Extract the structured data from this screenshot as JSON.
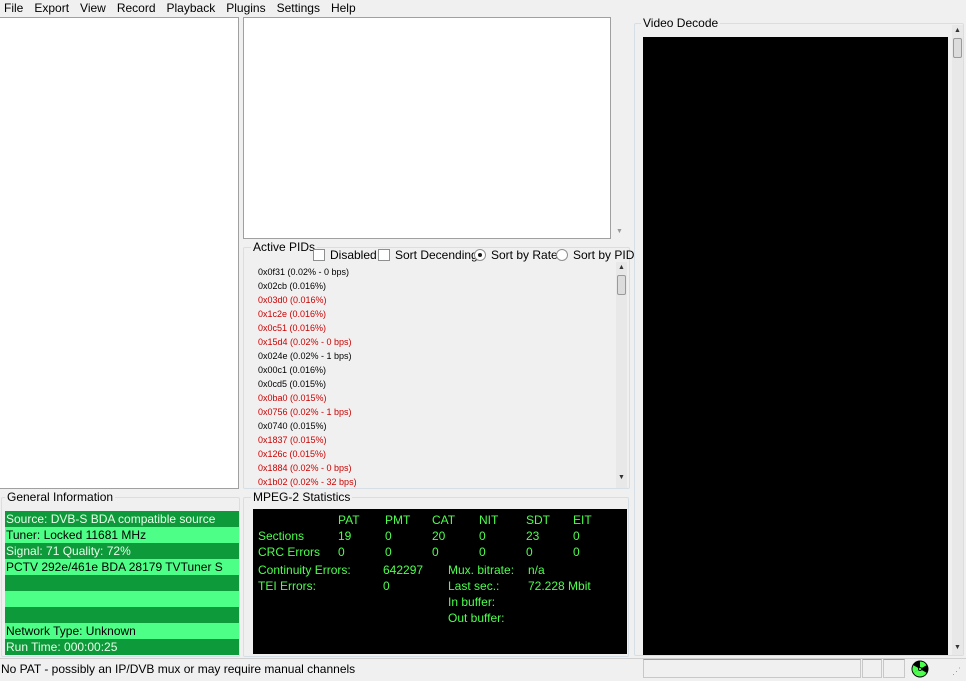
{
  "menu": [
    "File",
    "Export",
    "View",
    "Record",
    "Playback",
    "Plugins",
    "Settings",
    "Help"
  ],
  "video_decode": {
    "label": "Video Decode"
  },
  "active_pids": {
    "label": "Active PIDs",
    "options": {
      "disabled": "Disabled",
      "sort_descending": "Sort Decending",
      "sort_by_rate": "Sort by Rate",
      "sort_by_pid": "Sort by PID"
    },
    "selected_sort": "Sort by Rate",
    "items": [
      {
        "text": "0x0f31 (0.02% - 0 bps)",
        "color": "#000000"
      },
      {
        "text": "0x02cb (0.016%)",
        "color": "#000000"
      },
      {
        "text": "0x03d0 (0.016%)",
        "color": "#cc0000"
      },
      {
        "text": "0x1c2e (0.016%)",
        "color": "#cc0000"
      },
      {
        "text": "0x0c51 (0.016%)",
        "color": "#cc0000"
      },
      {
        "text": "0x15d4 (0.02% - 0 bps)",
        "color": "#cc0000"
      },
      {
        "text": "0x024e (0.02% - 1 bps)",
        "color": "#000000"
      },
      {
        "text": "0x00c1 (0.016%)",
        "color": "#000000"
      },
      {
        "text": "0x0cd5 (0.015%)",
        "color": "#000000"
      },
      {
        "text": "0x0ba0 (0.015%)",
        "color": "#cc0000"
      },
      {
        "text": "0x0756 (0.02% - 1 bps)",
        "color": "#cc0000"
      },
      {
        "text": "0x0740 (0.015%)",
        "color": "#000000"
      },
      {
        "text": "0x1837 (0.015%)",
        "color": "#cc0000"
      },
      {
        "text": "0x126c (0.015%)",
        "color": "#cc0000"
      },
      {
        "text": "0x1884 (0.02% - 0 bps)",
        "color": "#cc0000"
      },
      {
        "text": "0x1b02 (0.02% - 32 bps)",
        "color": "#cc0000"
      }
    ]
  },
  "general_info": {
    "label": "General Information",
    "rows": [
      {
        "text": "Source: DVB-S BDA compatible source",
        "style": "dark"
      },
      {
        "text": "Tuner: Locked 11681 MHz",
        "style": "light"
      },
      {
        "text": "Signal: 71 Quality: 72%",
        "style": "dark"
      },
      {
        "text": "PCTV 292e/461e BDA 28179 TVTuner S",
        "style": "light"
      },
      {
        "text": "",
        "style": "dark"
      },
      {
        "text": "",
        "style": "light"
      },
      {
        "text": "",
        "style": "dark"
      },
      {
        "text": "Network Type: Unknown",
        "style": "light"
      },
      {
        "text": "Run Time: 000:00:25",
        "style": "dark"
      }
    ]
  },
  "mpeg_stats": {
    "label": "MPEG-2 Statistics",
    "columns": [
      "PAT",
      "PMT",
      "CAT",
      "NIT",
      "SDT",
      "EIT"
    ],
    "sections_label": "Sections",
    "sections": [
      "19",
      "0",
      "20",
      "0",
      "23",
      "0"
    ],
    "crc_label": "CRC Errors",
    "crc": [
      "0",
      "0",
      "0",
      "0",
      "0",
      "0"
    ],
    "continuity_label": "Continuity Errors:",
    "continuity": "642297",
    "tei_label": "TEI Errors:",
    "tei": "0",
    "mux_bitrate_label": "Mux. bitrate:",
    "mux_bitrate": "n/a",
    "last_sec_label": "Last sec.:",
    "last_sec": "72.228 Mbit",
    "in_buffer_label": "In buffer:",
    "out_buffer_label": "Out buffer:"
  },
  "status_bar": {
    "message": "No PAT - possibly an IP/DVB mux or may require manual channels"
  },
  "colors": {
    "gi_dark": "#0d9a3a",
    "gi_light": "#4dff86",
    "stats_text": "#4dff4d",
    "pid_red": "#cc0000"
  }
}
